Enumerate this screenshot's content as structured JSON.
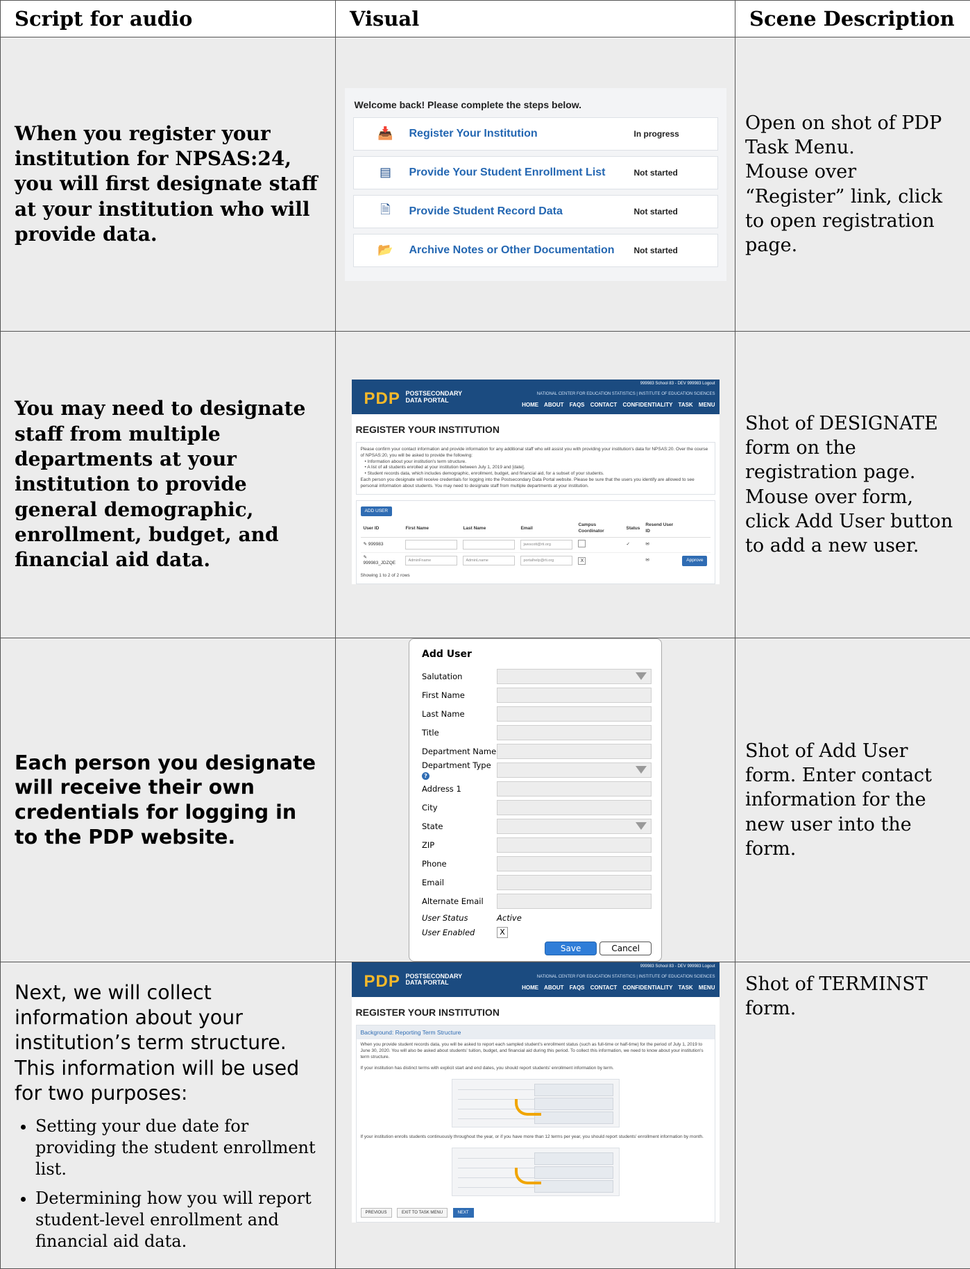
{
  "headers": {
    "script": "Script for audio",
    "visual": "Visual",
    "scene": "Scene Description"
  },
  "row1": {
    "script": "When you register your institution for NPSAS:24, you will first designate staff at your institution who will provide data.",
    "scene_lines": [
      "Open on shot of PDP Task Menu.",
      "Mouse over “Register” link, click to open registration page."
    ],
    "visual": {
      "welcome": "Welcome back! Please complete the steps below.",
      "tasks": [
        {
          "icon": "register-icon",
          "label": "Register Your Institution",
          "status": "In progress"
        },
        {
          "icon": "list-icon",
          "label": "Provide Your Student Enrollment List",
          "status": "Not started"
        },
        {
          "icon": "document-icon",
          "label": "Provide Student Record Data",
          "status": "Not started"
        },
        {
          "icon": "folder-icon",
          "label": "Archive Notes or Other Documentation",
          "status": "Not started"
        }
      ]
    }
  },
  "row2": {
    "script": "You may need to designate staff from multiple departments at your institution to provide general demographic, enrollment, budget, and financial aid data.",
    "scene": "Shot of DESIGNATE form on the registration page. Mouse over form, click Add User button to add a new user.",
    "visual": {
      "logo": "PDP",
      "logo_sub1": "POSTSECONDARY",
      "logo_sub2": "DATA PORTAL",
      "topline": "999983 School 83 - DEV  999983    Logout",
      "nces": "NATIONAL CENTER FOR EDUCATION STATISTICS  |  INSTITUTE OF EDUCATION SCIENCES",
      "nav": "HOME ABOUT FAQS CONTACT CONFIDENTIALITY TASK MENU",
      "page_title": "REGISTER YOUR INSTITUTION",
      "intro": "Please confirm your contact information and provide information for any additional staff who will assist you with providing your institution's data for NPSAS:20. Over the course of NPSAS:20, you will be asked to provide the following:",
      "bullets": [
        "• Information about your institution's term structure.",
        "• A list of all students enrolled at your institution between July 1, 2019 and [date].",
        "• Student records data, which includes demographic, enrollment, budget, and financial aid, for a subset of your students."
      ],
      "intro2": "Each person you designate will receive credentials for logging into the Postsecondary Data Portal website. Please be sure that the users you identify are allowed to see personal information about students. You may need to designate staff from multiple departments at your institution.",
      "add_user": "ADD USER",
      "columns": [
        "User ID",
        "First Name",
        "Last Name",
        "Email",
        "Campus Coordinator",
        "Status",
        "Resend User ID"
      ],
      "rows": [
        {
          "id": "999983",
          "first": "",
          "last": "",
          "email": "jwescott@rti.org",
          "coord": "",
          "status": "✓",
          "resend": "✉",
          "action": ""
        },
        {
          "id": "999983_JDZQE",
          "first": "AdminFname",
          "last": "AdminLname",
          "email": "portalhelp@rti.org",
          "coord": "X",
          "status": "",
          "resend": "✉",
          "action": "Approve"
        }
      ],
      "showing": "Showing 1 to 2 of 2 rows"
    }
  },
  "row3": {
    "script": "Each person you designate will receive their own credentials for logging in to the PDP website.",
    "scene": "Shot of Add User form. Enter contact information for the new user into the form.",
    "visual": {
      "title": "Add User",
      "fields": [
        {
          "label": "Salutation",
          "type": "select"
        },
        {
          "label": "First Name",
          "type": "text"
        },
        {
          "label": "Last Name",
          "type": "text"
        },
        {
          "label": "Title",
          "type": "text"
        },
        {
          "label": "Department Name",
          "type": "text"
        },
        {
          "label": "Department Type",
          "type": "select"
        },
        {
          "label": "Address 1",
          "type": "text"
        },
        {
          "label": "City",
          "type": "text"
        },
        {
          "label": "State",
          "type": "select"
        },
        {
          "label": "ZIP",
          "type": "text"
        },
        {
          "label": "Phone",
          "type": "text"
        },
        {
          "label": "Email",
          "type": "text"
        },
        {
          "label": "Alternate Email",
          "type": "text"
        }
      ],
      "status_label": "User Status",
      "status_value": "Active",
      "enabled_label": "User Enabled",
      "enabled_value": "X",
      "save": "Save",
      "cancel": "Cancel"
    }
  },
  "row4": {
    "script": "Next, we will collect information about your institution’s term structure. This information will be used for two purposes:",
    "bullets": [
      "Setting your due date for providing the student enrollment list.",
      "Determining how you will report student-level enrollment and financial aid data."
    ],
    "scene": "Shot of TERMINST form.",
    "visual": {
      "section": "Background: Reporting Term Structure",
      "para1": "When you provide student records data, you will be asked to report each sampled student's enrollment status (such as full-time or half-time) for the period of July 1, 2019 to June 30, 2020. You will also be asked about students' tuition, budget, and financial aid during this period. To collect this information, we need to know about your institution's term structure.",
      "para2": "If your institution has distinct terms with explicit start and end dates, you should report students' enrollment information by term.",
      "para3": "If your institution enrolls students continuously throughout the year, or if you have more than 12 terms per year, you should report students' enrollment information by month.",
      "buttons": [
        "PREVIOUS",
        "EXIT TO TASK MENU",
        "NEXT"
      ]
    }
  }
}
